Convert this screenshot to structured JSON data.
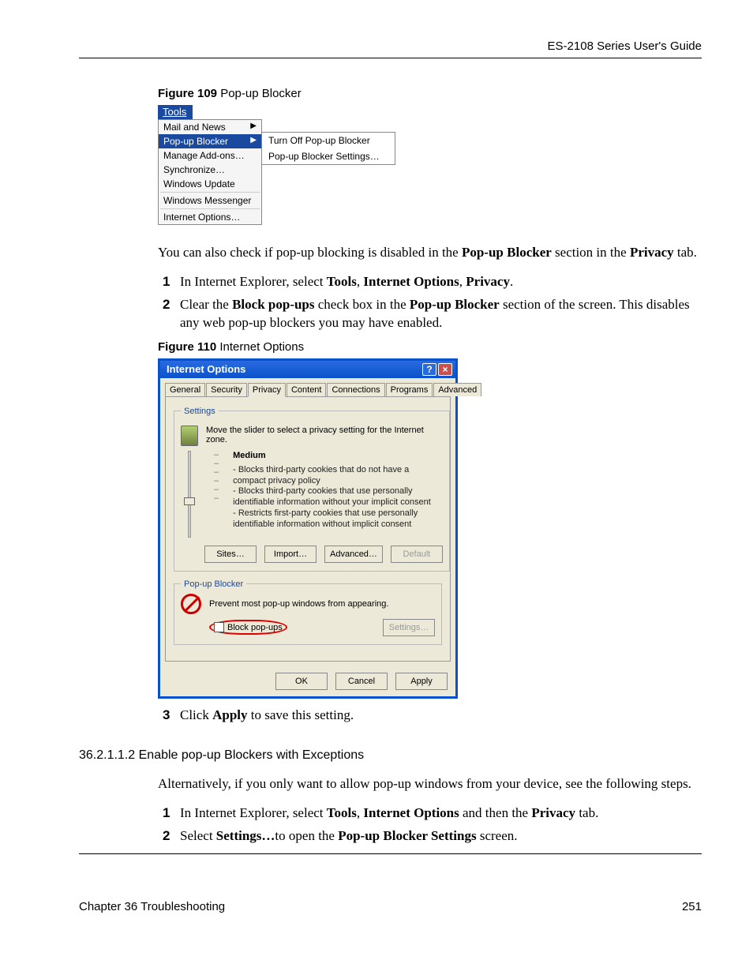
{
  "header": {
    "guide": "ES-2108 Series User's Guide"
  },
  "fig109": {
    "caption_bold": "Figure 109",
    "caption_text": "   Pop-up Blocker",
    "tools_label": "Tools",
    "items": {
      "mail_news": "Mail and News",
      "popup": "Pop-up Blocker",
      "addons": "Manage Add-ons…",
      "sync": "Synchronize…",
      "wupdate": "Windows Update",
      "messenger": "Windows Messenger",
      "inetopt": "Internet Options…"
    },
    "sub": {
      "turn_off": "Turn Off Pop-up Blocker",
      "settings": "Pop-up Blocker Settings…"
    }
  },
  "para1_a": "You can also check if pop-up blocking is disabled in the ",
  "para1_b": "Pop-up Blocker",
  "para1_c": " section in the ",
  "para1_d": "Privacy",
  "para1_e": " tab.",
  "steps1": {
    "n1": "1",
    "s1a": "In Internet Explorer, select ",
    "s1b": "Tools",
    "s1c": ", ",
    "s1d": "Internet Options",
    "s1e": ", ",
    "s1f": "Privacy",
    "s1g": ".",
    "n2": "2",
    "s2a": "Clear the ",
    "s2b": "Block pop-ups",
    "s2c": " check box in the ",
    "s2d": "Pop-up Blocker",
    "s2e": " section of the screen. This disables any web pop-up blockers you may have enabled."
  },
  "fig110": {
    "caption_bold": "Figure 110",
    "caption_text": "   Internet Options",
    "title": "Internet Options",
    "tabs": [
      "General",
      "Security",
      "Privacy",
      "Content",
      "Connections",
      "Programs",
      "Advanced"
    ],
    "settings_legend": "Settings",
    "slider_hint": "Move the slider to select a privacy setting for the Internet zone.",
    "level": "Medium",
    "level_desc": "- Blocks third-party cookies that do not have a compact privacy policy\n- Blocks third-party cookies that use personally identifiable information without your implicit consent\n- Restricts first-party cookies that use personally identifiable information without implicit consent",
    "btn_sites": "Sites…",
    "btn_import": "Import…",
    "btn_advanced": "Advanced…",
    "btn_default": "Default",
    "popup_legend": "Pop-up Blocker",
    "popup_hint": "Prevent most pop-up windows from appearing.",
    "popup_chk": "Block pop-ups",
    "btn_settings": "Settings…",
    "btn_ok": "OK",
    "btn_cancel": "Cancel",
    "btn_apply": "Apply"
  },
  "steps1b": {
    "n3": "3",
    "s3a": "Click ",
    "s3b": "Apply",
    "s3c": " to save this setting."
  },
  "sec": {
    "num": "36.2.1.1.2  Enable pop-up Blockers with Exceptions"
  },
  "para2": "Alternatively, if you only want to allow pop-up windows from your device, see the following steps.",
  "steps2": {
    "n1": "1",
    "s1a": "In Internet Explorer, select ",
    "s1b": "Tools",
    "s1c": ", ",
    "s1d": "Internet Options",
    "s1e": " and then the ",
    "s1f": "Privacy",
    "s1g": " tab.",
    "n2": "2",
    "s2a": "Select ",
    "s2b": "Settings…",
    "s2c": "to open the ",
    "s2d": "Pop-up Blocker Settings",
    "s2e": " screen."
  },
  "footer": {
    "left": "Chapter 36 Troubleshooting",
    "right": "251"
  }
}
